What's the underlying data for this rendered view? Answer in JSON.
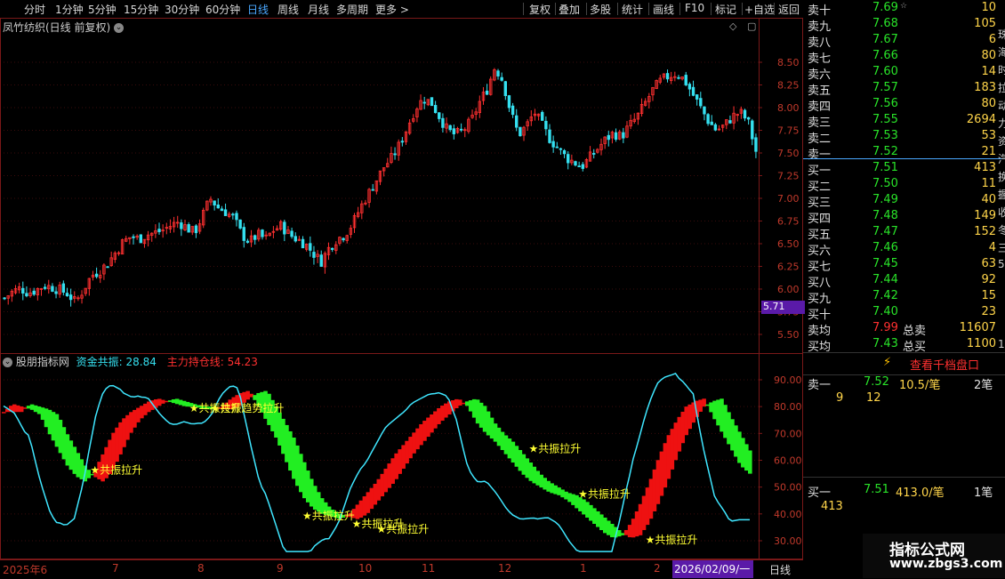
{
  "toolbar": {
    "periods": [
      "分时",
      "1分钟",
      "5分钟",
      "15分钟",
      "30分钟",
      "60分钟",
      "日线",
      "周线",
      "月线",
      "多周期",
      "更多 >"
    ],
    "active_period": "日线",
    "actions": [
      "复权",
      "叠加",
      "多股",
      "统计",
      "画线",
      "F10",
      "标记",
      "+自选",
      "返回"
    ]
  },
  "main_chart": {
    "title": "凤竹纺织(日线 前复权)",
    "y_ticks": [
      "8.50",
      "8.25",
      "8.00",
      "7.75",
      "7.50",
      "7.25",
      "7.00",
      "6.75",
      "6.50",
      "6.25",
      "6.00",
      "5.75",
      "5.50"
    ],
    "y_tick_values": [
      8.5,
      8.25,
      8.0,
      7.75,
      7.5,
      7.25,
      7.0,
      6.75,
      6.5,
      6.25,
      6.0,
      5.75,
      5.5
    ],
    "low_marker": "5.71",
    "candle_source": [
      5.9,
      5.97,
      6.01,
      5.96,
      5.99,
      6.04,
      6.02,
      5.99,
      5.95,
      5.85,
      6.0,
      6.15,
      6.2,
      6.28,
      6.4,
      6.52,
      6.58,
      6.55,
      6.6,
      6.62,
      6.65,
      6.7,
      6.74,
      6.68,
      6.62,
      6.8,
      7.0,
      6.9,
      6.85,
      6.78,
      6.6,
      6.52,
      6.6,
      6.55,
      6.65,
      6.7,
      6.6,
      6.55,
      6.5,
      6.4,
      6.3,
      6.45,
      6.55,
      6.6,
      6.72,
      6.9,
      7.05,
      7.2,
      7.35,
      7.45,
      7.6,
      7.8,
      8.0,
      8.1,
      8.05,
      7.9,
      7.75,
      7.7,
      7.75,
      7.85,
      8.05,
      8.2,
      8.45,
      8.3,
      7.95,
      7.7,
      7.8,
      7.95,
      7.8,
      7.65,
      7.55,
      7.45,
      7.4,
      7.35,
      7.45,
      7.55,
      7.65,
      7.72,
      7.68,
      7.8,
      7.9,
      8.05,
      8.2,
      8.3,
      8.35,
      8.38,
      8.3,
      8.15,
      8.0,
      7.85,
      7.75,
      7.8,
      7.9,
      7.95,
      7.85,
      7.52
    ]
  },
  "indicator": {
    "name": "股朋指标网",
    "series1_label": "资金共振: 28.84",
    "series2_label": "主力持仓线: 54.23",
    "y_ticks": [
      "90.00",
      "80.00",
      "70.00",
      "60.00",
      "50.00",
      "40.00",
      "30.00"
    ],
    "y_tick_values": [
      90,
      80,
      70,
      60,
      50,
      40,
      30
    ],
    "signal_text": "共振拉升",
    "signals": [
      {
        "text": "★共振拉升",
        "at": 26,
        "value": 55
      },
      {
        "text": "★共振拉升",
        "at": 54,
        "value": 78
      },
      {
        "text": "★共振趋势拉升",
        "at": 60,
        "value": 78
      },
      {
        "text": "★共振拉升",
        "at": 86,
        "value": 38
      },
      {
        "text": "★共振拉升",
        "at": 100,
        "value": 35
      },
      {
        "text": "★共振拉升",
        "at": 107,
        "value": 33
      },
      {
        "text": "★共振拉升",
        "at": 150,
        "value": 63
      },
      {
        "text": "★共振拉升",
        "at": 164,
        "value": 46
      },
      {
        "text": "★共振拉升",
        "at": 183,
        "value": 29
      }
    ],
    "hold_line": [
      78,
      81,
      80,
      79,
      77,
      70,
      64,
      58,
      54,
      52,
      56,
      63,
      70,
      75,
      78,
      80,
      82,
      83,
      82,
      81,
      80,
      80,
      79,
      79,
      80,
      83,
      85,
      86,
      80,
      74,
      68,
      60,
      52,
      46,
      42,
      40,
      39,
      38,
      40,
      44,
      48,
      52,
      57,
      62,
      66,
      70,
      74,
      77,
      80,
      82,
      83,
      80,
      74,
      70,
      67,
      63,
      59,
      55,
      52,
      50,
      48,
      47,
      45,
      42,
      39,
      36,
      33,
      31,
      32,
      37,
      44,
      52,
      61,
      69,
      75,
      80,
      82,
      83,
      76,
      70,
      64,
      58,
      55
    ]
  },
  "x_axis": {
    "labels": [
      "2025年6",
      "7",
      "8",
      "9",
      "10",
      "11",
      "12",
      "1",
      "2"
    ],
    "date_badge": "2026/02/09/一",
    "period_label": "日线"
  },
  "orderbook": {
    "asks": [
      {
        "label": "卖十",
        "price": "7.69",
        "vol": "10"
      },
      {
        "label": "卖九",
        "price": "7.68",
        "vol": "105"
      },
      {
        "label": "卖八",
        "price": "7.67",
        "vol": "6"
      },
      {
        "label": "卖七",
        "price": "7.66",
        "vol": "80"
      },
      {
        "label": "卖六",
        "price": "7.60",
        "vol": "14"
      },
      {
        "label": "卖五",
        "price": "7.57",
        "vol": "183"
      },
      {
        "label": "卖四",
        "price": "7.56",
        "vol": "80"
      },
      {
        "label": "卖三",
        "price": "7.55",
        "vol": "2694"
      },
      {
        "label": "卖二",
        "price": "7.53",
        "vol": "53"
      },
      {
        "label": "卖一",
        "price": "7.52",
        "vol": "21"
      }
    ],
    "bids": [
      {
        "label": "买一",
        "price": "7.51",
        "vol": "413"
      },
      {
        "label": "买二",
        "price": "7.50",
        "vol": "11"
      },
      {
        "label": "买三",
        "price": "7.49",
        "vol": "40"
      },
      {
        "label": "买四",
        "price": "7.48",
        "vol": "149"
      },
      {
        "label": "买五",
        "price": "7.47",
        "vol": "152"
      },
      {
        "label": "买六",
        "price": "7.46",
        "vol": "4"
      },
      {
        "label": "买七",
        "price": "7.45",
        "vol": "63"
      },
      {
        "label": "买八",
        "price": "7.44",
        "vol": "92"
      },
      {
        "label": "买九",
        "price": "7.42",
        "vol": "15"
      },
      {
        "label": "买十",
        "price": "7.40",
        "vol": "23"
      }
    ],
    "avg_sell": {
      "label": "卖均",
      "price": "7.99",
      "total_label": "总卖",
      "total": "11607"
    },
    "avg_buy": {
      "label": "买均",
      "price": "7.43",
      "total_label": "总买",
      "total": "1100"
    },
    "star_mark": "☆"
  },
  "depth_panel": {
    "button": "查看千档盘口",
    "sell1": {
      "label": "卖一",
      "price": "7.52",
      "per": "10.5/笔",
      "count": "2笔",
      "detail": [
        "9",
        "12"
      ]
    },
    "buy1": {
      "label": "买一",
      "price": "7.51",
      "per": "413.0/笔",
      "count": "1笔",
      "detail": [
        "413"
      ]
    }
  },
  "right_edge": {
    "chars": [
      "珠",
      "海",
      "时",
      "拉",
      "动",
      "力",
      "资",
      "汽",
      "换",
      "握",
      "收",
      "冬",
      "三",
      "5"
    ],
    "bottom_char": "1"
  },
  "watermark": {
    "title": "指标公式网",
    "url": "www.zbgs3.com"
  },
  "colors": {
    "up": "#ff3030",
    "down": "#35e0f0",
    "green": "#22ee22",
    "red": "#ee1111",
    "axis_red": "#7a1818",
    "signal": "#ffff33",
    "accent_blue": "#4aa8ff",
    "purple": "#5a1aa8"
  }
}
